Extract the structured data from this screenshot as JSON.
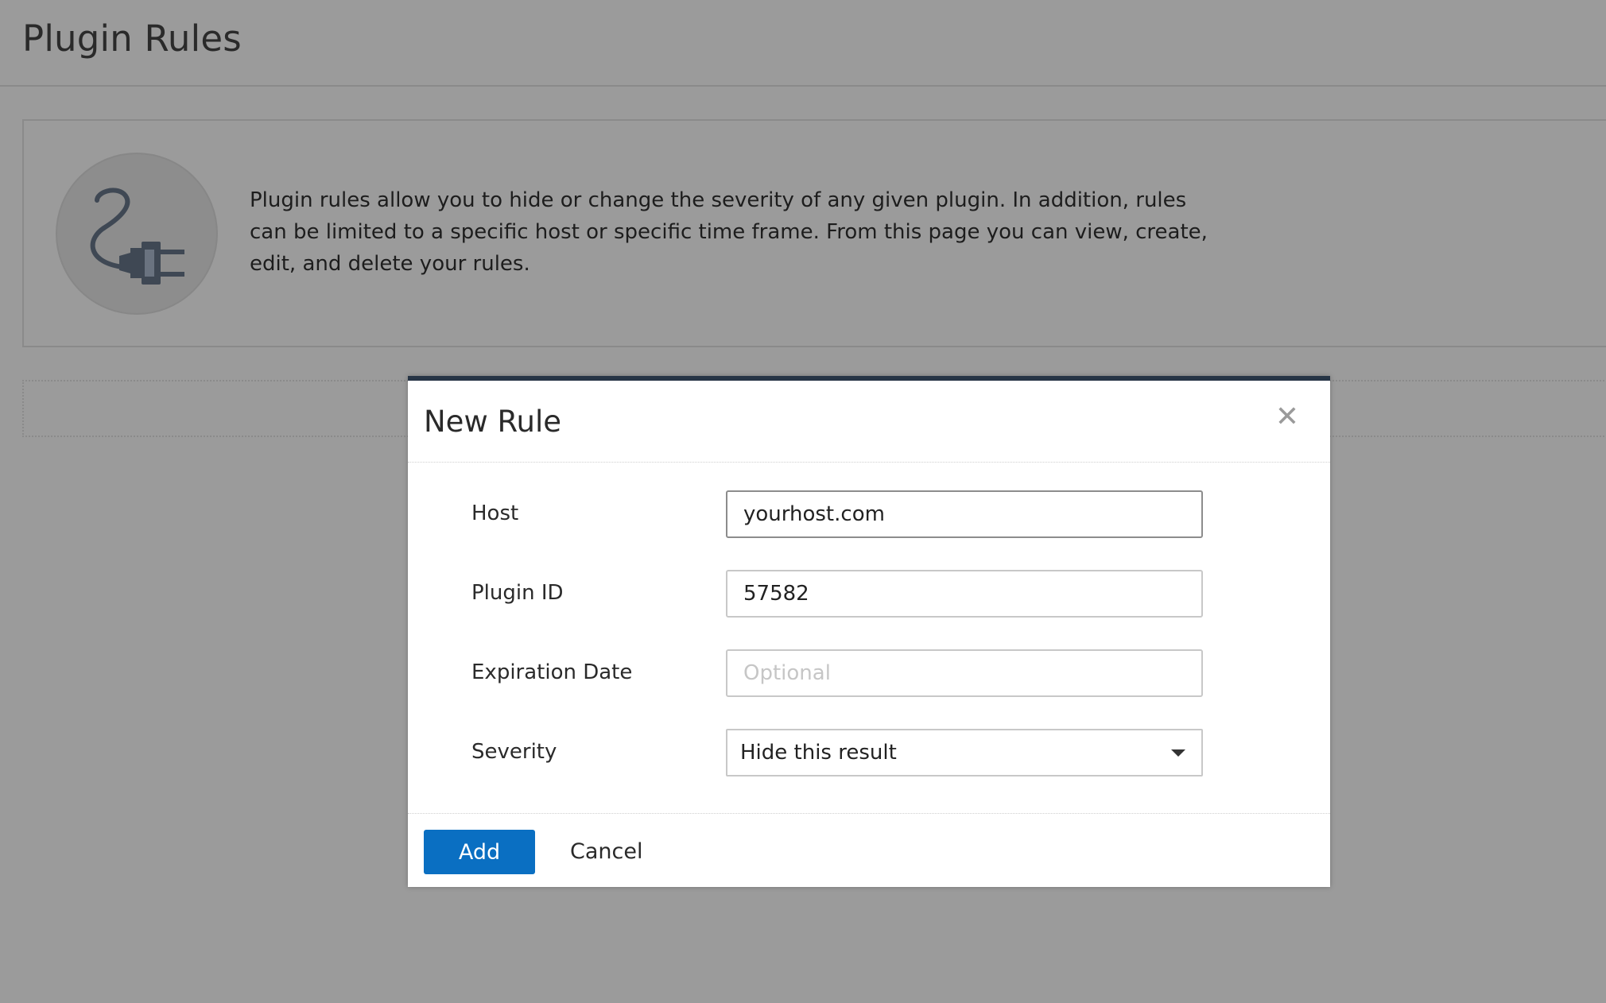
{
  "page": {
    "title": "Plugin Rules",
    "info_text": "Plugin rules allow you to hide or change the severity of any given plugin. In addition, rules can be limited to a specific host or specific time frame. From this page you can view, create, edit, and delete your rules."
  },
  "modal": {
    "title": "New Rule",
    "close_icon": "close-icon",
    "fields": {
      "host": {
        "label": "Host",
        "value": "yourhost.com"
      },
      "plugin_id": {
        "label": "Plugin ID",
        "value": "57582"
      },
      "expiration_date": {
        "label": "Expiration Date",
        "value": "",
        "placeholder": "Optional"
      },
      "severity": {
        "label": "Severity",
        "value": "Hide this result"
      }
    },
    "footer": {
      "add_label": "Add",
      "cancel_label": "Cancel"
    }
  },
  "colors": {
    "overlay_background": "#9b9b9b",
    "modal_top_border": "#263445",
    "primary_button": "#0a6fc2"
  }
}
